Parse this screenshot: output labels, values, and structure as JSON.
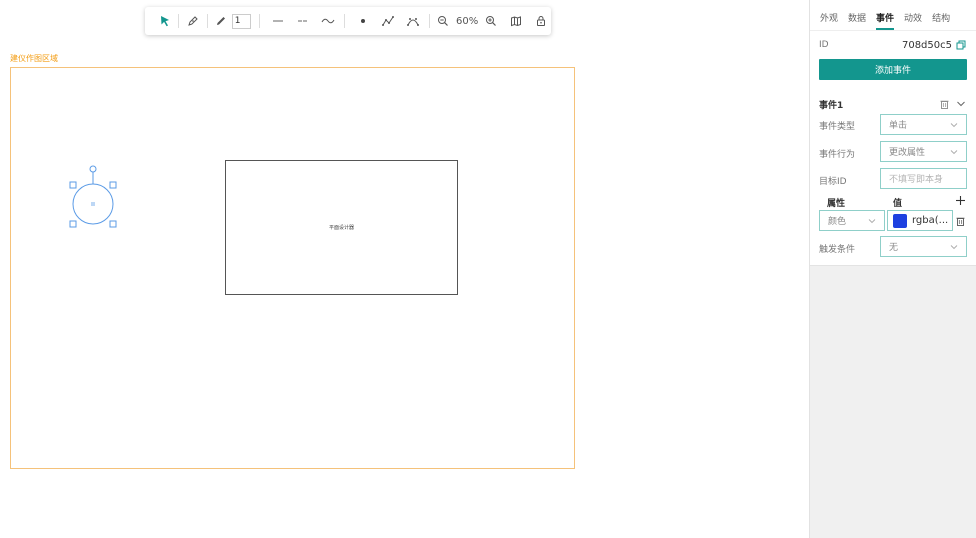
{
  "toolbar": {
    "line_width": "1",
    "zoom": "60%"
  },
  "canvas": {
    "area_label": "建仪作图区域",
    "rect_text": "平面设计器"
  },
  "panel": {
    "tabs": [
      "外观",
      "数据",
      "事件",
      "动效",
      "结构"
    ],
    "active_tab": "事件",
    "id_label": "ID",
    "id_value": "708d50c5",
    "add_event_button": "添加事件",
    "event_title": "事件1",
    "event_type_label": "事件类型",
    "event_type_value": "单击",
    "event_action_label": "事件行为",
    "event_action_value": "更改属性",
    "target_id_label": "目标ID",
    "target_id_placeholder": "不填写即本身",
    "attr_header": "属性",
    "value_header": "值",
    "attr_value": "颜色",
    "color_value": "rgba(...",
    "trigger_label": "触发条件",
    "trigger_value": "无"
  },
  "colors": {
    "accent": "#13968e",
    "canvas_border": "#f5c27a",
    "selection": "#5b9be6",
    "swatch": "#1e40e0"
  }
}
